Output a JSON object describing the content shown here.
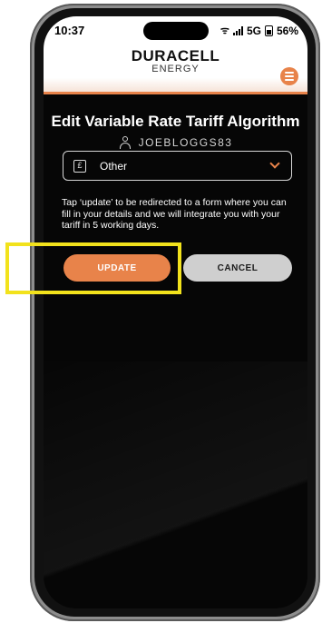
{
  "status_bar": {
    "time": "10:37",
    "network": "5G",
    "battery": "56%"
  },
  "header": {
    "logo_main": "DURACELL",
    "logo_sub": "ENERGY",
    "menu_icon": "hamburger-icon"
  },
  "page": {
    "title": "Edit Variable Rate Tariff Algorithm",
    "username": "JOEBLOGGS83"
  },
  "tariff_select": {
    "icon_glyph": "£",
    "selected": "Other"
  },
  "info": {
    "text": "Tap ‘update’ to be redirected to a form where you can fill in your details and we will integrate you with your tariff in 5 working days."
  },
  "actions": {
    "update_label": "UPDATE",
    "cancel_label": "CANCEL"
  },
  "colors": {
    "accent": "#e8834a",
    "highlight": "#f2e21c",
    "background": "#060606"
  }
}
